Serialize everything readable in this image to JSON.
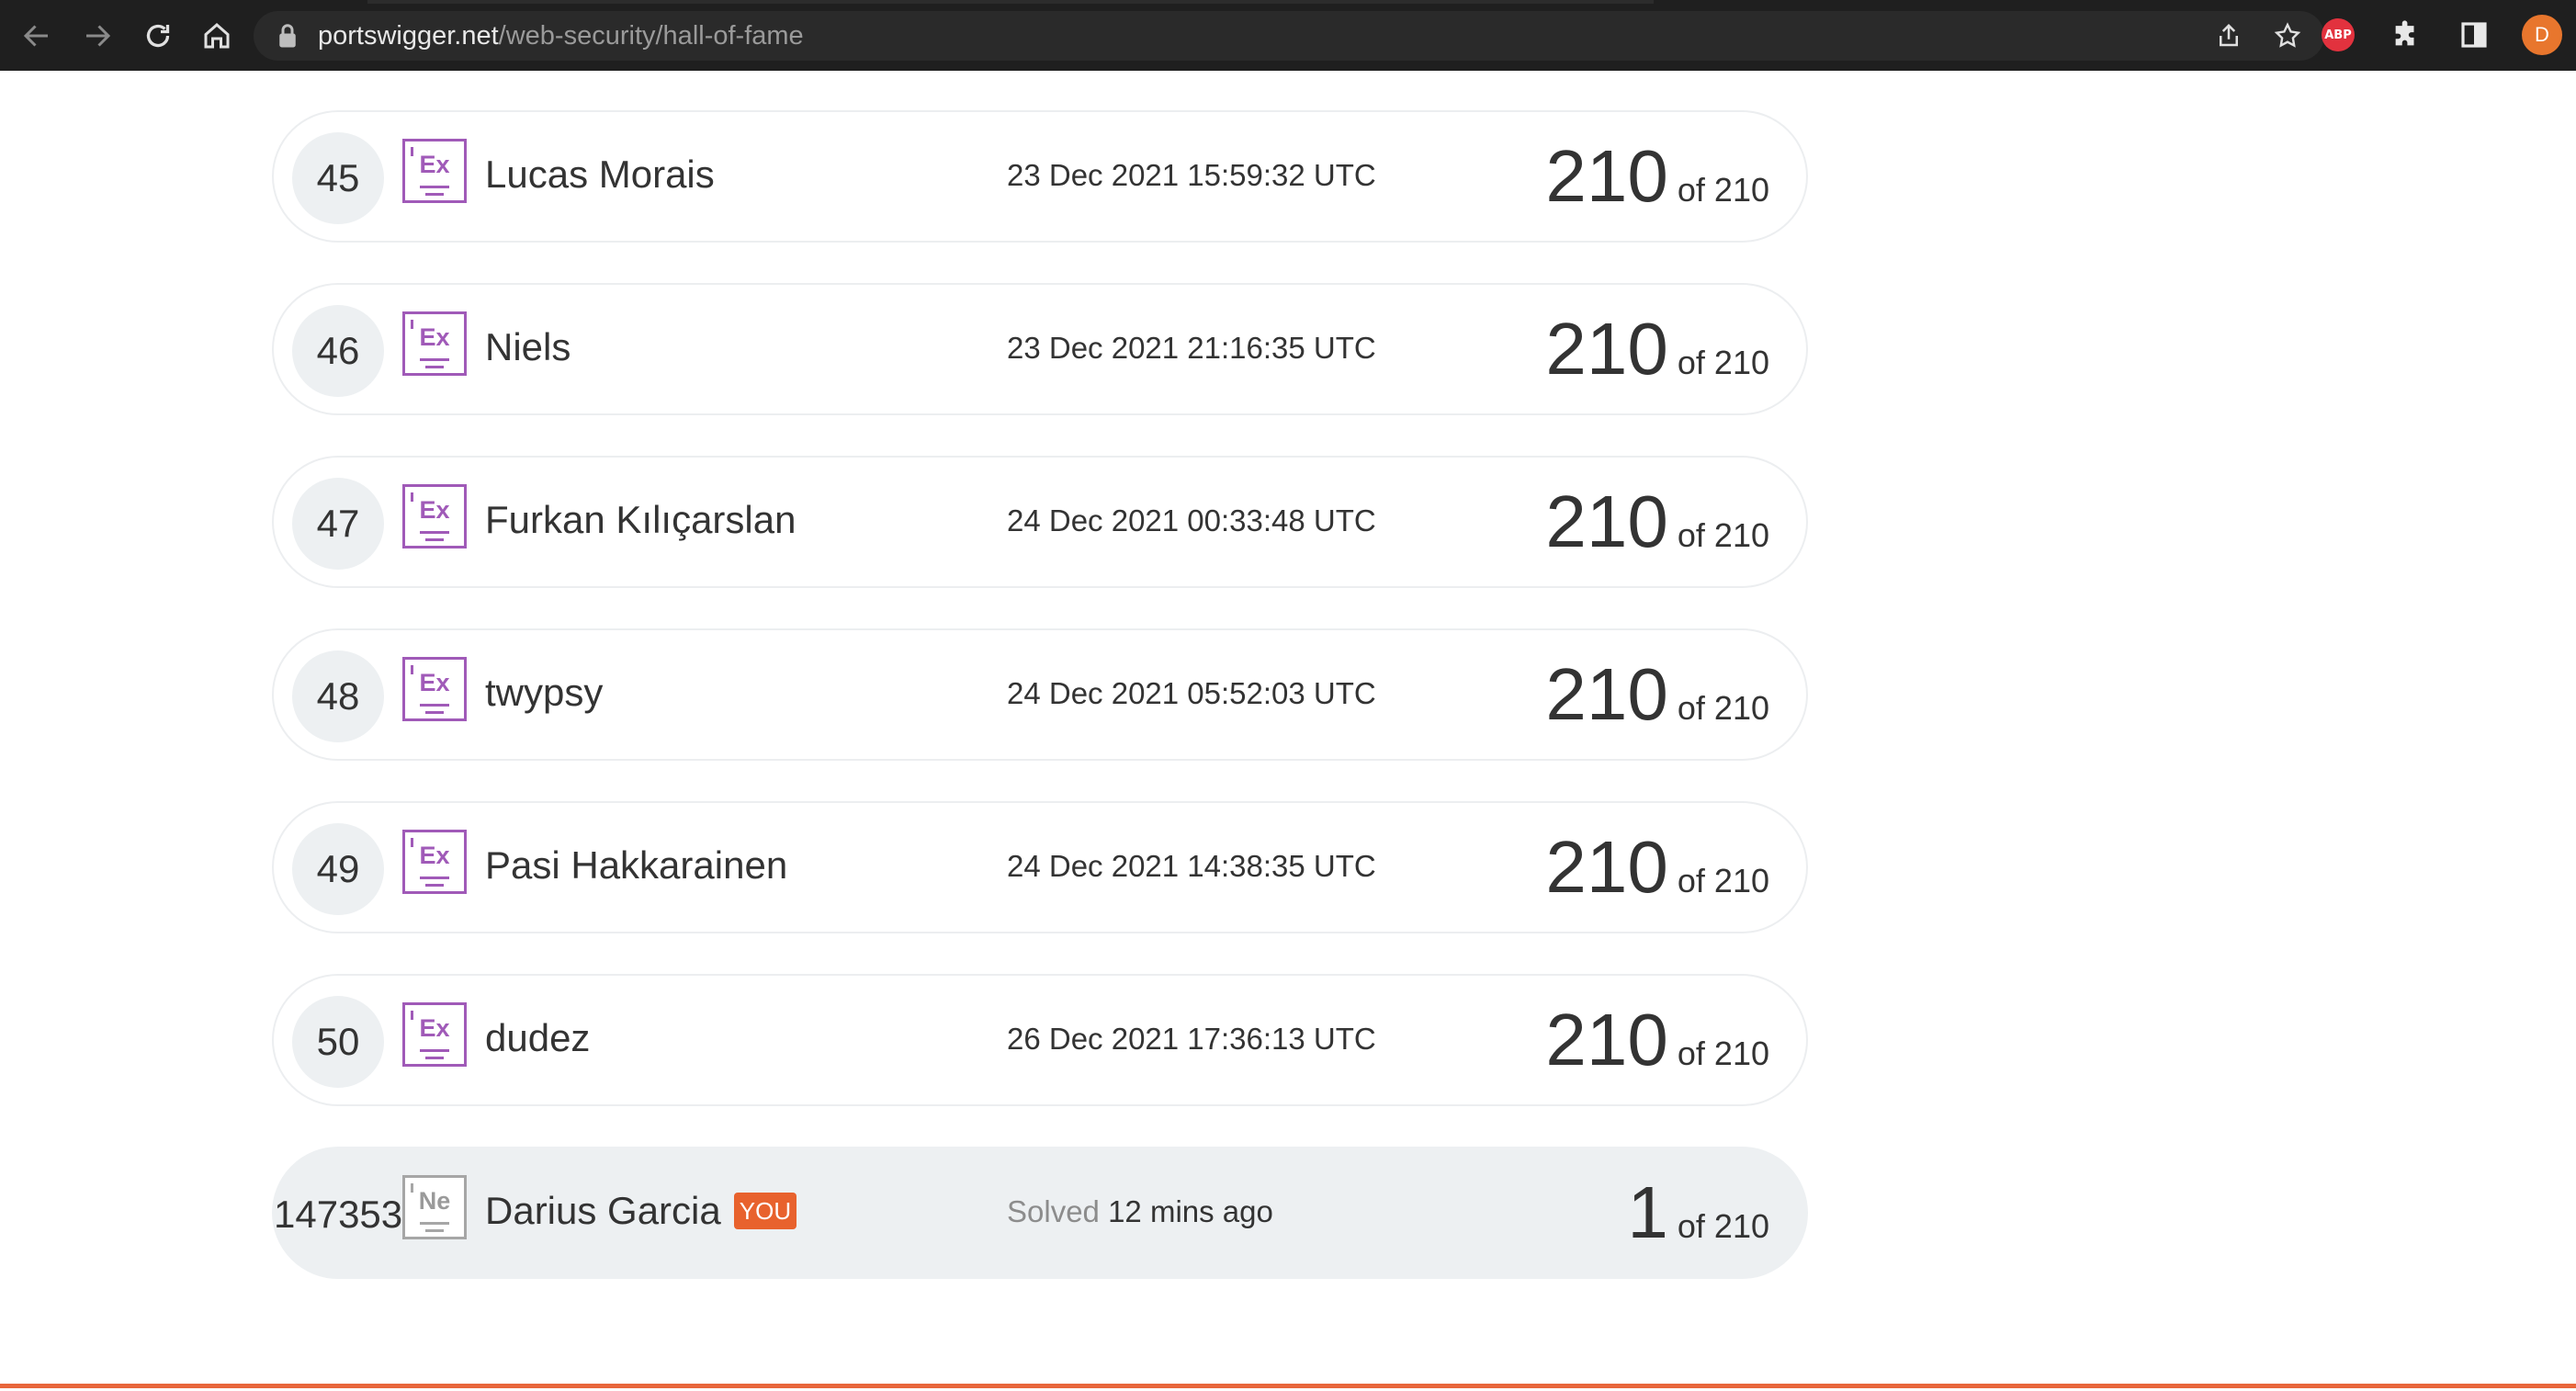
{
  "browser": {
    "url_host": "portswigger.net",
    "url_path": "/web-security/hall-of-fame",
    "abp_label": "ABP",
    "profile_initial": "D"
  },
  "leaderboard": {
    "rows": [
      {
        "rank": "45",
        "level": "Ex",
        "name": "Lucas Morais",
        "date": "23 Dec 2021 15:59:32 UTC",
        "score": "210",
        "total": "of 210"
      },
      {
        "rank": "46",
        "level": "Ex",
        "name": "Niels",
        "date": "23 Dec 2021 21:16:35 UTC",
        "score": "210",
        "total": "of 210"
      },
      {
        "rank": "47",
        "level": "Ex",
        "name": "Furkan Kılıçarslan",
        "date": "24 Dec 2021 00:33:48 UTC",
        "score": "210",
        "total": "of 210"
      },
      {
        "rank": "48",
        "level": "Ex",
        "name": "twypsy",
        "date": "24 Dec 2021 05:52:03 UTC",
        "score": "210",
        "total": "of 210"
      },
      {
        "rank": "49",
        "level": "Ex",
        "name": "Pasi Hakkarainen",
        "date": "24 Dec 2021 14:38:35 UTC",
        "score": "210",
        "total": "of 210"
      },
      {
        "rank": "50",
        "level": "Ex",
        "name": "dudez",
        "date": "26 Dec 2021 17:36:13 UTC",
        "score": "210",
        "total": "of 210"
      }
    ],
    "me": {
      "rank": "147353",
      "level": "Ne",
      "name": "Darius Garcia",
      "badge": "YOU",
      "solved_label": "Solved",
      "solved_when": "12 mins ago",
      "score": "1",
      "total": "of 210"
    }
  },
  "colors": {
    "expert_purple": "#a05ab8",
    "you_badge": "#e8622d",
    "accent_rule": "#e8663b"
  }
}
